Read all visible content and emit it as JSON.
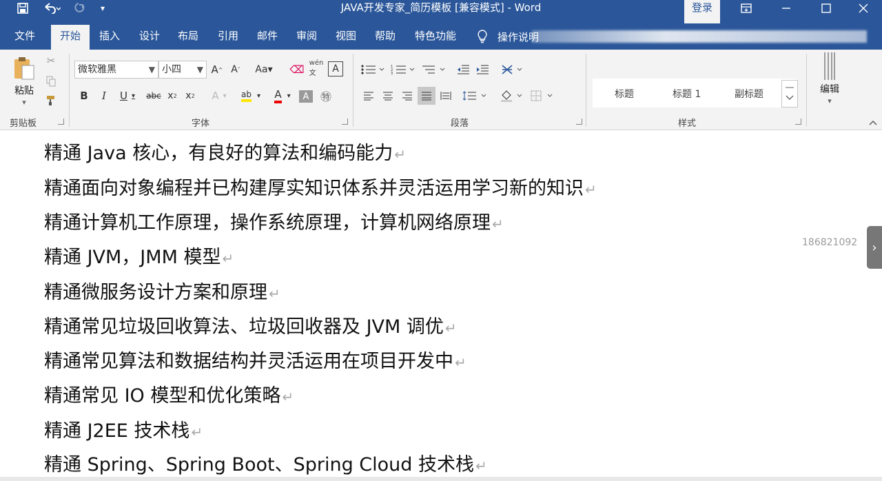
{
  "window": {
    "title": "JAVA开发专家_简历模板 [兼容模式] - Word",
    "login_label": "登录",
    "minimize_icon": "minimize-icon",
    "restore_icon": "ribbon-display-icon",
    "close_icon": "close-icon"
  },
  "quick_access": {
    "icons": [
      "save-icon",
      "undo-icon",
      "redo-icon",
      "customize-icon"
    ]
  },
  "tabs": [
    {
      "label": "文件"
    },
    {
      "label": "开始",
      "active": true
    },
    {
      "label": "插入"
    },
    {
      "label": "设计"
    },
    {
      "label": "布局"
    },
    {
      "label": "引用"
    },
    {
      "label": "邮件"
    },
    {
      "label": "审阅"
    },
    {
      "label": "视图"
    },
    {
      "label": "帮助"
    },
    {
      "label": "特色功能"
    }
  ],
  "tell_me": {
    "label": "操作说明"
  },
  "ribbon": {
    "clipboard": {
      "paste_label": "粘贴",
      "group_label": "剪贴板"
    },
    "font": {
      "font_name": "微软雅黑",
      "font_size": "小四",
      "group_label": "字体"
    },
    "paragraph": {
      "group_label": "段落"
    },
    "styles": {
      "items": [
        "标题",
        "标题 1",
        "副标题"
      ],
      "group_label": "样式"
    },
    "editing": {
      "label": "编辑"
    }
  },
  "document": {
    "lines": [
      "精通 Java  核心，有良好的算法和编码能力",
      "精通面向对象编程并已构建厚实知识体系并灵活运用学习新的知识",
      "精通计算机工作原理，操作系统原理，计算机网络原理",
      "精通 JVM，JMM 模型",
      "精通微服务设计方案和原理",
      "精通常见垃圾回收算法、垃圾回收器及 JVM 调优",
      "精通常见算法和数据结构并灵活运用在项目开发中",
      "精通常见 IO 模型和优化策略",
      "精通 J2EE 技术栈",
      "精通 Spring、Spring Boot、Spring Cloud 技术栈"
    ],
    "paragraph_mark": "↵",
    "watermark": "186821092"
  },
  "colors": {
    "accent": "#2b579a",
    "ribbon_bg": "#f3f3f3"
  }
}
